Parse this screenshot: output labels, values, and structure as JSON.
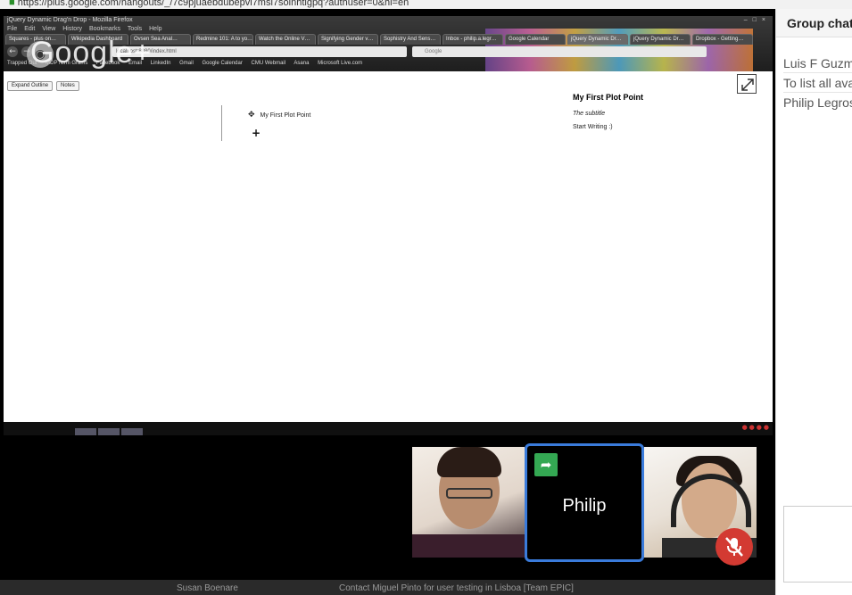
{
  "host_browser": {
    "url_text": "https://plus.google.com/hangouts/_/7c9pjuaebdubepvi7msi7solnhtlgpq?authuser=0&hl=en"
  },
  "shared_screen": {
    "window_title": "jQuery Dynamic Drag'n Drop - Mozilla Firefox",
    "menu": [
      "File",
      "Edit",
      "View",
      "History",
      "Bookmarks",
      "Tools",
      "Help"
    ],
    "tabs": [
      "Squares - plus on…",
      "Wikipedia Dashboard",
      "Ovsen Sea Anal…",
      "Redmine 101: A to yo…",
      "Watch the Online V…",
      "Signifying Gender v…",
      "Sophistry And Sens…",
      "Inbox - philip.a.legr…",
      "Google Calendar",
      "jQuery Dynamic Dr…",
      "jQuery Dynamic Dr…",
      "Dropbox - Getting…"
    ],
    "url_text": "localhost:8080/index.html",
    "search_placeholder": "Google",
    "bookmarks": [
      "Trapped Out",
      "MDP Nirm Grams",
      "Facebook",
      "Email",
      "LinkedIn",
      "Gmail",
      "Google Calendar",
      "CMU Webmail",
      "Asana",
      "Microsoft Live.com"
    ],
    "watermark": "Google+",
    "toolbar_buttons": [
      "Expand Outline",
      "Notes"
    ],
    "plot_point_label": "My First Plot Point",
    "add_symbol": "+",
    "detail": {
      "title": "My First Plot Point",
      "subtitle": "The subtitle",
      "body": "Start Writing :)"
    }
  },
  "participants": {
    "active_name": "Philip"
  },
  "host_bottom": {
    "name": "Susan Boenare",
    "subject": "Contact Miguel Pinto for user testing in Lisboa [Team EPIC]"
  },
  "chat": {
    "header": "Group chat",
    "lines": [
      "Luis F Guzman",
      "To list all available",
      "Philip Legros"
    ]
  },
  "colors": {
    "active_tile_border": "#3a7bdb",
    "share_badge": "#34a853",
    "mute_badge": "#d33a32"
  }
}
